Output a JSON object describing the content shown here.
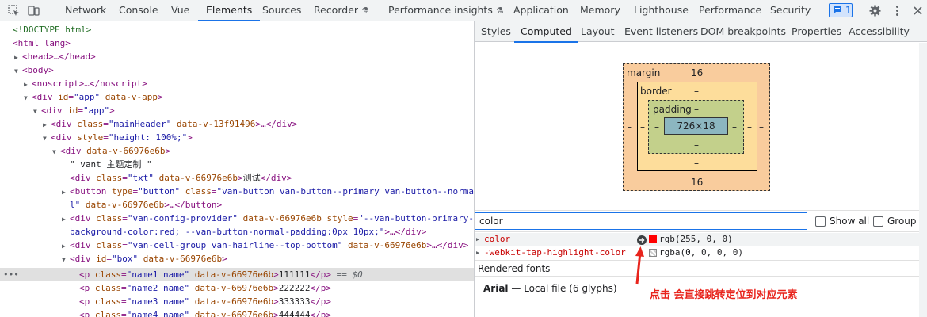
{
  "topbar": {
    "tabs": [
      "Network",
      "Console",
      "Vue",
      "Elements",
      "Sources",
      "Recorder",
      "Performance insights",
      "Application",
      "Memory",
      "Lighthouse",
      "Performance",
      "Security"
    ],
    "active_tab": "Elements",
    "issues_count": "1",
    "accent": "#1a73e8"
  },
  "dom": {
    "doctype": "<!DOCTYPE html>",
    "html_open": "<html lang>",
    "head": "<head>…</head>",
    "body_open": "<body>",
    "noscript": "<noscript>…</noscript>",
    "l5_tag": "<div ",
    "l5_a1": "id",
    "l5_v1": "\"app\"",
    "l5_a2": "data-v-app",
    "l5_close": ">",
    "l6_tag": "<div ",
    "l6_a1": "id",
    "l6_v1": "\"app\"",
    "l6_close": ">",
    "l7_tag": "<div ",
    "l7_a1": "class",
    "l7_v1": "\"mainHeader\"",
    "l7_a2": "data-v-13f91496",
    "l7_close": ">…</div>",
    "l8_tag": "<div ",
    "l8_a1": "style",
    "l8_v1": "\"height: 100%;\"",
    "l8_close": ">",
    "l9_tag": "<div ",
    "l9_a1": "data-v-66976e6b",
    "l9_close": ">",
    "l10_text": "\" vant 主题定制 \"",
    "l11_tag": "<div ",
    "l11_a1": "class",
    "l11_v1": "\"txt\"",
    "l11_a2": "data-v-66976e6b",
    "l11_text": "测试",
    "l11_close": "</div>",
    "l12_tag": "<button ",
    "l12_a1": "type",
    "l12_v1": "\"button\"",
    "l12_a2": "class",
    "l12_v2": "\"van-button van-button--primary van-button--norma",
    "l13_v": "l\"",
    "l13_a": "data-v-66976e6b",
    "l13_close": ">…</button>",
    "l14_tag": "<div ",
    "l14_a1": "class",
    "l14_v1": "\"van-config-provider\"",
    "l14_a2": "data-v-66976e6b",
    "l14_a3": "style",
    "l14_v3": "\"--van-button-primary-",
    "l15_v": "background-color:red; --van-button-normal-padding:0px 10px;\"",
    "l15_close": ">…</div>",
    "l16_tag": "<div ",
    "l16_a1": "class",
    "l16_v1": "\"van-cell-group van-hairline--top-bottom\"",
    "l16_a2": "data-v-66976e6b",
    "l16_close": ">…</div>",
    "l17_tag": "<div ",
    "l17_a1": "id",
    "l17_v1": "\"box\"",
    "l17_a2": "data-v-66976e6b",
    "l17_close": ">",
    "selected_marker": "== $0",
    "p_rows": [
      {
        "cls": "\"name1 name\"",
        "text": "111111"
      },
      {
        "cls": "\"name2 name\"",
        "text": "222222"
      },
      {
        "cls": "\"name3 name\"",
        "text": "333333"
      },
      {
        "cls": "\"name4 name\"",
        "text": "444444"
      }
    ],
    "p_tag": "<p ",
    "p_attr": "class",
    "p_attr2": "data-v-66976e6b",
    "p_close": "</p>"
  },
  "styles_tabs": [
    "Styles",
    "Computed",
    "Layout",
    "Event listeners",
    "DOM breakpoints",
    "Properties",
    "Accessibility"
  ],
  "active_styles_tab": "Computed",
  "box_model": {
    "margin_label": "margin",
    "margin_top": "16",
    "margin_bottom": "16",
    "margin_left": "–",
    "margin_right": "–",
    "border_label": "border",
    "border_top": "–",
    "border_bottom": "–",
    "border_left": "–",
    "border_right": "–",
    "padding_label": "padding",
    "padding_top": "–",
    "padding_bottom": "–",
    "padding_left": "–",
    "padding_right": "–",
    "content": "726×18",
    "colors": {
      "margin": "#f9cc9d",
      "border": "#fddd9b",
      "padding": "#c3d08b",
      "content": "#8cb6c0"
    }
  },
  "filter": {
    "value": "color",
    "show_all_label": "Show all",
    "group_label": "Group"
  },
  "computed": [
    {
      "name": "color",
      "value": "rgb(255, 0, 0)",
      "swatch": "#ff0000"
    },
    {
      "name": "-webkit-tap-highlight-color",
      "value": "rgba(0, 0, 0, 0)",
      "swatch": "transparent"
    }
  ],
  "rendered_fonts": {
    "title": "Rendered fonts",
    "font": "Arial",
    "dash": "—",
    "detail": "Local file (6 glyphs)"
  },
  "annotation": "点击 会直接跳转定位到对应元素"
}
